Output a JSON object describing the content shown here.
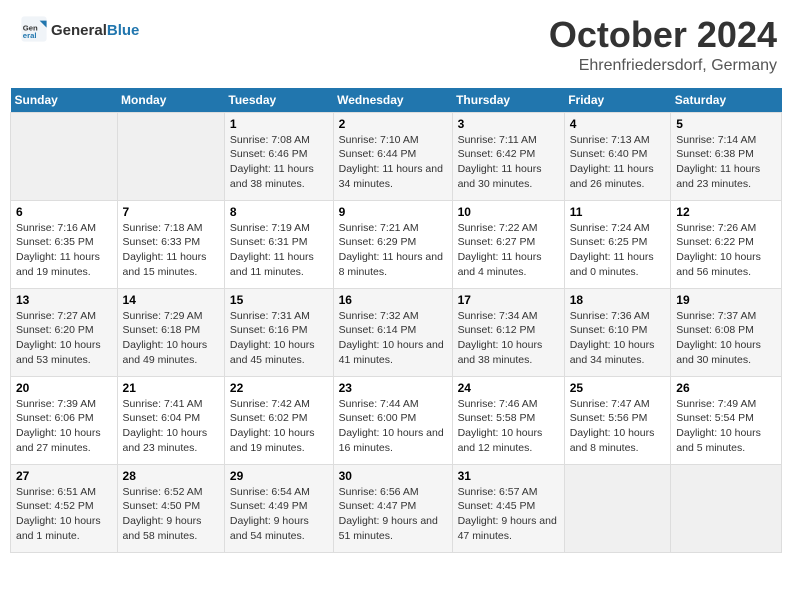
{
  "header": {
    "logo_general": "General",
    "logo_blue": "Blue",
    "month": "October 2024",
    "location": "Ehrenfriedersdorf, Germany"
  },
  "weekdays": [
    "Sunday",
    "Monday",
    "Tuesday",
    "Wednesday",
    "Thursday",
    "Friday",
    "Saturday"
  ],
  "weeks": [
    [
      {
        "day": "",
        "empty": true
      },
      {
        "day": "",
        "empty": true
      },
      {
        "day": "1",
        "sunrise": "Sunrise: 7:08 AM",
        "sunset": "Sunset: 6:46 PM",
        "daylight": "Daylight: 11 hours and 38 minutes."
      },
      {
        "day": "2",
        "sunrise": "Sunrise: 7:10 AM",
        "sunset": "Sunset: 6:44 PM",
        "daylight": "Daylight: 11 hours and 34 minutes."
      },
      {
        "day": "3",
        "sunrise": "Sunrise: 7:11 AM",
        "sunset": "Sunset: 6:42 PM",
        "daylight": "Daylight: 11 hours and 30 minutes."
      },
      {
        "day": "4",
        "sunrise": "Sunrise: 7:13 AM",
        "sunset": "Sunset: 6:40 PM",
        "daylight": "Daylight: 11 hours and 26 minutes."
      },
      {
        "day": "5",
        "sunrise": "Sunrise: 7:14 AM",
        "sunset": "Sunset: 6:38 PM",
        "daylight": "Daylight: 11 hours and 23 minutes."
      }
    ],
    [
      {
        "day": "6",
        "sunrise": "Sunrise: 7:16 AM",
        "sunset": "Sunset: 6:35 PM",
        "daylight": "Daylight: 11 hours and 19 minutes."
      },
      {
        "day": "7",
        "sunrise": "Sunrise: 7:18 AM",
        "sunset": "Sunset: 6:33 PM",
        "daylight": "Daylight: 11 hours and 15 minutes."
      },
      {
        "day": "8",
        "sunrise": "Sunrise: 7:19 AM",
        "sunset": "Sunset: 6:31 PM",
        "daylight": "Daylight: 11 hours and 11 minutes."
      },
      {
        "day": "9",
        "sunrise": "Sunrise: 7:21 AM",
        "sunset": "Sunset: 6:29 PM",
        "daylight": "Daylight: 11 hours and 8 minutes."
      },
      {
        "day": "10",
        "sunrise": "Sunrise: 7:22 AM",
        "sunset": "Sunset: 6:27 PM",
        "daylight": "Daylight: 11 hours and 4 minutes."
      },
      {
        "day": "11",
        "sunrise": "Sunrise: 7:24 AM",
        "sunset": "Sunset: 6:25 PM",
        "daylight": "Daylight: 11 hours and 0 minutes."
      },
      {
        "day": "12",
        "sunrise": "Sunrise: 7:26 AM",
        "sunset": "Sunset: 6:22 PM",
        "daylight": "Daylight: 10 hours and 56 minutes."
      }
    ],
    [
      {
        "day": "13",
        "sunrise": "Sunrise: 7:27 AM",
        "sunset": "Sunset: 6:20 PM",
        "daylight": "Daylight: 10 hours and 53 minutes."
      },
      {
        "day": "14",
        "sunrise": "Sunrise: 7:29 AM",
        "sunset": "Sunset: 6:18 PM",
        "daylight": "Daylight: 10 hours and 49 minutes."
      },
      {
        "day": "15",
        "sunrise": "Sunrise: 7:31 AM",
        "sunset": "Sunset: 6:16 PM",
        "daylight": "Daylight: 10 hours and 45 minutes."
      },
      {
        "day": "16",
        "sunrise": "Sunrise: 7:32 AM",
        "sunset": "Sunset: 6:14 PM",
        "daylight": "Daylight: 10 hours and 41 minutes."
      },
      {
        "day": "17",
        "sunrise": "Sunrise: 7:34 AM",
        "sunset": "Sunset: 6:12 PM",
        "daylight": "Daylight: 10 hours and 38 minutes."
      },
      {
        "day": "18",
        "sunrise": "Sunrise: 7:36 AM",
        "sunset": "Sunset: 6:10 PM",
        "daylight": "Daylight: 10 hours and 34 minutes."
      },
      {
        "day": "19",
        "sunrise": "Sunrise: 7:37 AM",
        "sunset": "Sunset: 6:08 PM",
        "daylight": "Daylight: 10 hours and 30 minutes."
      }
    ],
    [
      {
        "day": "20",
        "sunrise": "Sunrise: 7:39 AM",
        "sunset": "Sunset: 6:06 PM",
        "daylight": "Daylight: 10 hours and 27 minutes."
      },
      {
        "day": "21",
        "sunrise": "Sunrise: 7:41 AM",
        "sunset": "Sunset: 6:04 PM",
        "daylight": "Daylight: 10 hours and 23 minutes."
      },
      {
        "day": "22",
        "sunrise": "Sunrise: 7:42 AM",
        "sunset": "Sunset: 6:02 PM",
        "daylight": "Daylight: 10 hours and 19 minutes."
      },
      {
        "day": "23",
        "sunrise": "Sunrise: 7:44 AM",
        "sunset": "Sunset: 6:00 PM",
        "daylight": "Daylight: 10 hours and 16 minutes."
      },
      {
        "day": "24",
        "sunrise": "Sunrise: 7:46 AM",
        "sunset": "Sunset: 5:58 PM",
        "daylight": "Daylight: 10 hours and 12 minutes."
      },
      {
        "day": "25",
        "sunrise": "Sunrise: 7:47 AM",
        "sunset": "Sunset: 5:56 PM",
        "daylight": "Daylight: 10 hours and 8 minutes."
      },
      {
        "day": "26",
        "sunrise": "Sunrise: 7:49 AM",
        "sunset": "Sunset: 5:54 PM",
        "daylight": "Daylight: 10 hours and 5 minutes."
      }
    ],
    [
      {
        "day": "27",
        "sunrise": "Sunrise: 6:51 AM",
        "sunset": "Sunset: 4:52 PM",
        "daylight": "Daylight: 10 hours and 1 minute."
      },
      {
        "day": "28",
        "sunrise": "Sunrise: 6:52 AM",
        "sunset": "Sunset: 4:50 PM",
        "daylight": "Daylight: 9 hours and 58 minutes."
      },
      {
        "day": "29",
        "sunrise": "Sunrise: 6:54 AM",
        "sunset": "Sunset: 4:49 PM",
        "daylight": "Daylight: 9 hours and 54 minutes."
      },
      {
        "day": "30",
        "sunrise": "Sunrise: 6:56 AM",
        "sunset": "Sunset: 4:47 PM",
        "daylight": "Daylight: 9 hours and 51 minutes."
      },
      {
        "day": "31",
        "sunrise": "Sunrise: 6:57 AM",
        "sunset": "Sunset: 4:45 PM",
        "daylight": "Daylight: 9 hours and 47 minutes."
      },
      {
        "day": "",
        "empty": true
      },
      {
        "day": "",
        "empty": true
      }
    ]
  ]
}
